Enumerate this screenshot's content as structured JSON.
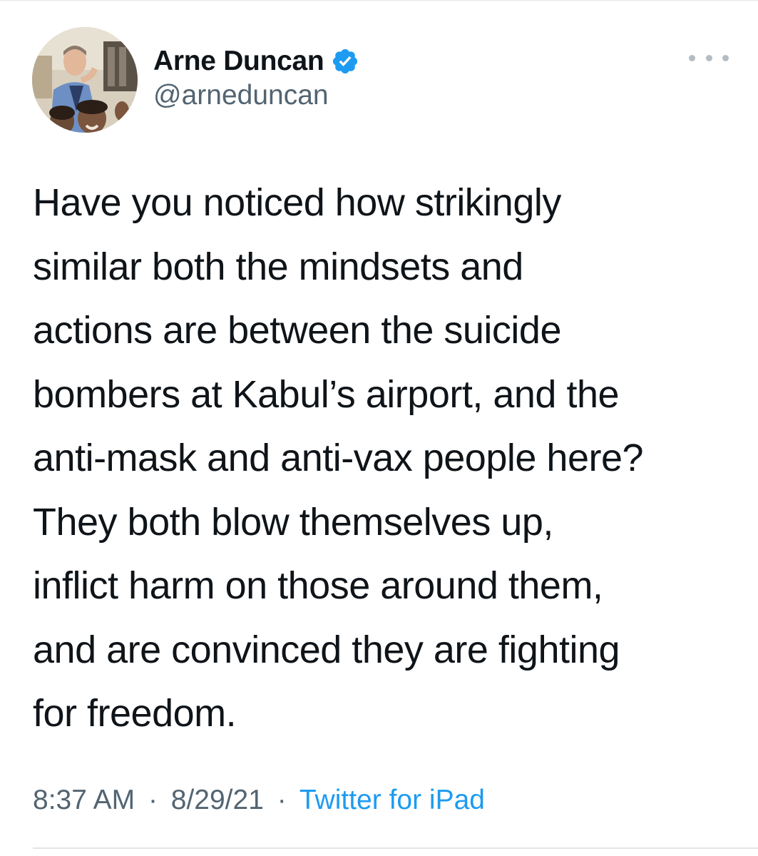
{
  "author": {
    "display_name": "Arne Duncan",
    "handle": "@arneduncan",
    "verified": true,
    "avatar_icon": "profile-photo",
    "verified_icon": "verified-badge-icon",
    "verified_color": "#1d9bf0"
  },
  "more_icon": "more-options-icon",
  "tweet": {
    "text": "Have you noticed how strikingly\nsimilar both the mindsets and\nactions are between the suicide\nbombers at Kabul’s airport, and the\nanti-mask and anti-vax people here?\nThey both blow themselves up,\ninflict harm on those around them,\nand are convinced they are fighting\nfor freedom."
  },
  "meta": {
    "time": "8:37 AM",
    "date": "8/29/21",
    "separator": "·",
    "source": "Twitter for iPad",
    "source_color": "#1d9bf0"
  }
}
